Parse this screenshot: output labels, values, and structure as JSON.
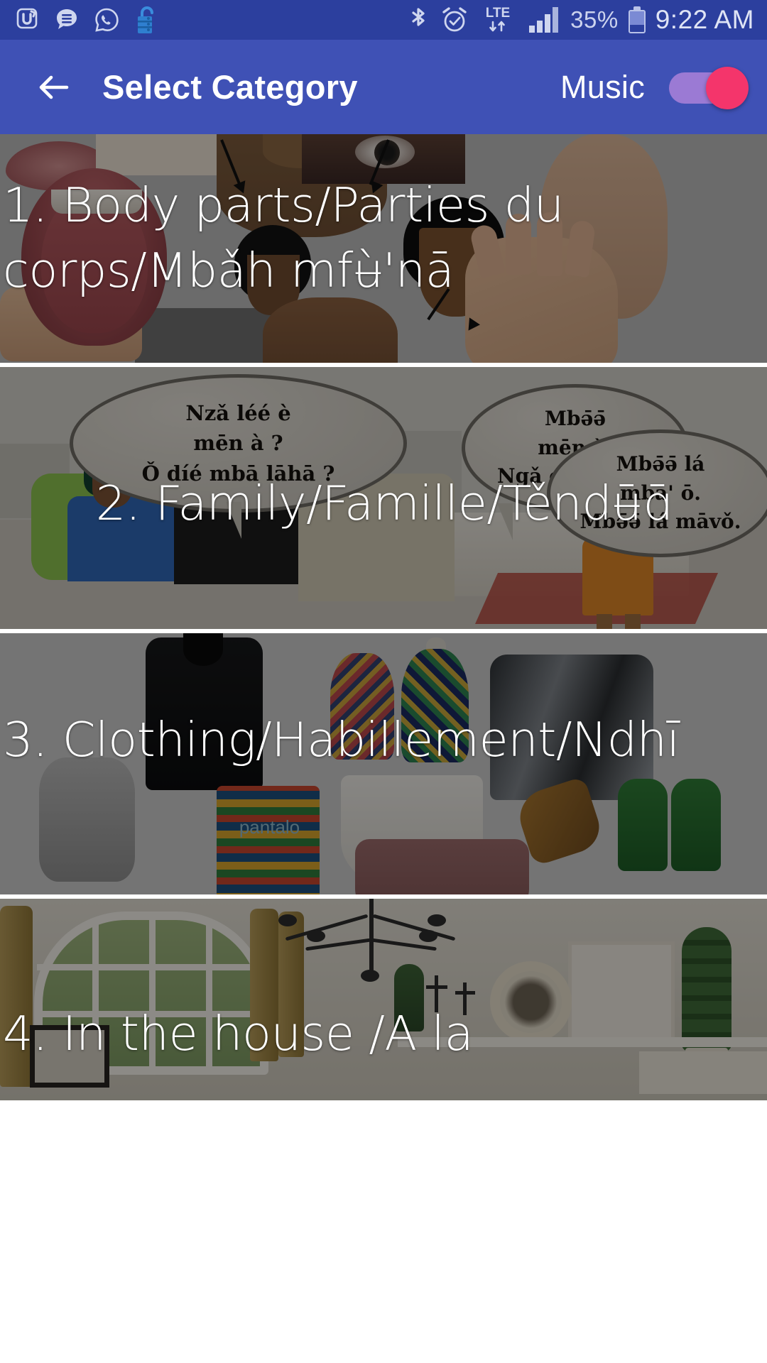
{
  "status_bar": {
    "left_icons": [
      "messenger-u-icon",
      "sms-chat-icon",
      "whatsapp-icon",
      "unlocked-padlock-icon"
    ],
    "right_icons": [
      "bluetooth-icon",
      "alarm-clock-icon",
      "lte-data-icon",
      "signal-bars-icon"
    ],
    "network_label": "LTE",
    "battery_percent": "35%",
    "clock": "9:22 AM"
  },
  "app_bar": {
    "back_icon": "arrow-left-icon",
    "title": "Select Category",
    "music_label": "Music",
    "music_toggle_on": true,
    "accent_color": "#3f51b5",
    "toggle_thumb_color": "#f4356b",
    "toggle_track_color": "#9b7ad4"
  },
  "categories": [
    {
      "number": "1.",
      "label": "1. Body parts/Parties du corps/Mbǎh mfʉ̀'nā",
      "art": "body-parts-collage"
    },
    {
      "number": "2.",
      "label": "2. Family/Famille/Těndʉ̄ɑ̄",
      "art": "family-comic-scene",
      "speech_bubbles": [
        "Nzǎ léé è mēn à ? Ǒ díé mbā lāhā ?",
        "Mbǝ̄ǝ̄ mēn à. Ngǎ cà'sì ō lá.",
        "Mbǝ̄ǝ̄ lá mbā' ō. Mbǝ̄ǝ̄ lá māvǒ."
      ],
      "bubble_lines": [
        [
          "Nzǎ léé è",
          "mēn à ?",
          "Ǒ díé mbā lāhā ?"
        ],
        [
          "Mbǝ̄ǝ̄",
          "mēn à.",
          "Ngǎ cà'sì ō lá."
        ],
        [
          "Mbǝ̄ǝ̄ lá",
          "mbā' ō.",
          "Mbǝ̄ǝ̄ lá māvǒ."
        ]
      ]
    },
    {
      "number": "3.",
      "label": "3. Clothing/Habillement/Ndhī",
      "art": "clothing-collage",
      "pants_text": "pantalo"
    },
    {
      "number": "4.",
      "label": "4. In the house /A la",
      "art": "house-interior-photo"
    }
  ]
}
